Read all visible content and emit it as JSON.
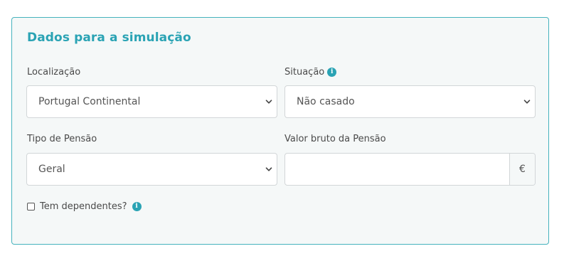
{
  "form": {
    "title": "Dados para a simulação",
    "localizacao": {
      "label": "Localização",
      "selected": "Portugal Continental"
    },
    "situacao": {
      "label": "Situação",
      "selected": "Não casado"
    },
    "tipo_pensao": {
      "label": "Tipo de Pensão",
      "selected": "Geral"
    },
    "valor_bruto": {
      "label": "Valor bruto da Pensão",
      "value": "",
      "currency": "€"
    },
    "dependentes": {
      "label": "Tem dependentes?",
      "checked": false
    }
  },
  "icons": {
    "info": "info-icon",
    "dropdown": "chevron-down-icon"
  },
  "colors": {
    "accent": "#2aa3b4",
    "border": "#46b2bd",
    "panel_bg": "#f5f8f8"
  }
}
